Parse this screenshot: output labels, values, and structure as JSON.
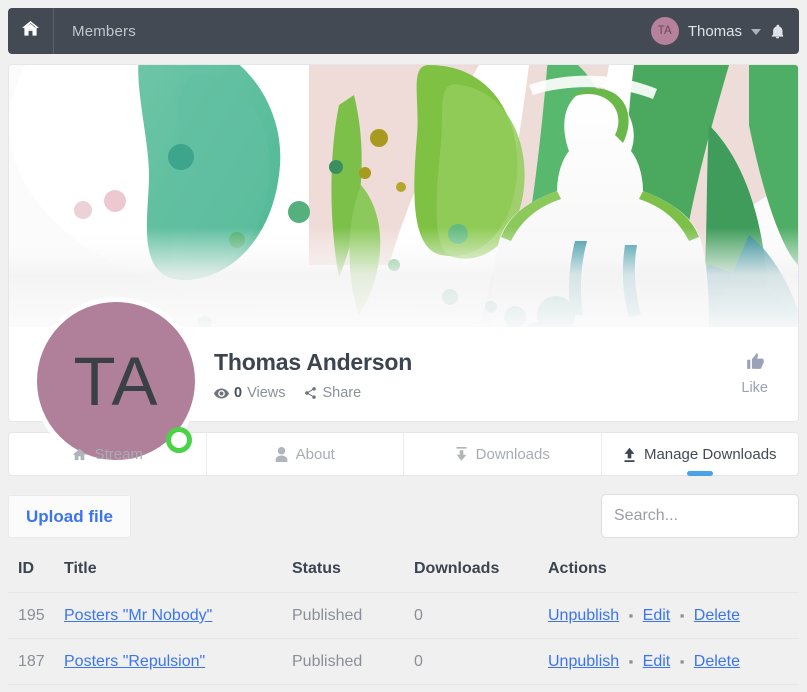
{
  "topbar": {
    "home_icon": "home-icon",
    "breadcrumb": "Members",
    "avatar_initials": "TA",
    "username": "Thomas",
    "caret_icon": "chevron-down-icon",
    "bell_icon": "bell-icon"
  },
  "profile": {
    "avatar_initials": "TA",
    "name": "Thomas Anderson",
    "views_count": "0",
    "views_label": "Views",
    "share_label": "Share",
    "like_label": "Like",
    "eye_icon": "eye-icon",
    "share_icon": "share-icon",
    "like_icon": "thumbs-up-icon",
    "status": "online"
  },
  "tabs": [
    {
      "label": "Stream",
      "icon": "home-icon",
      "active": false
    },
    {
      "label": "About",
      "icon": "user-icon",
      "active": false
    },
    {
      "label": "Downloads",
      "icon": "download-icon",
      "active": false
    },
    {
      "label": "Manage Downloads",
      "icon": "upload-icon",
      "active": true
    }
  ],
  "toolbar": {
    "upload_label": "Upload file",
    "search_value": "",
    "search_placeholder": "Search..."
  },
  "table": {
    "headers": [
      "ID",
      "Title",
      "Status",
      "Downloads",
      "Actions"
    ],
    "rows": [
      {
        "id": "195",
        "title": "Posters \"Mr Nobody\"",
        "status": "Published",
        "downloads": "0",
        "actions": [
          "Unpublish",
          "Edit",
          "Delete"
        ]
      },
      {
        "id": "187",
        "title": "Posters \"Repulsion\"",
        "status": "Published",
        "downloads": "0",
        "actions": [
          "Unpublish",
          "Edit",
          "Delete"
        ]
      }
    ],
    "action_separator": "▪"
  },
  "colors": {
    "navbar": "#434a54",
    "accent_link": "#3b74f2",
    "tab_active_underline": "#4aa3e8",
    "avatar_bg": "#b0809a",
    "status_online": "#4bd246"
  }
}
